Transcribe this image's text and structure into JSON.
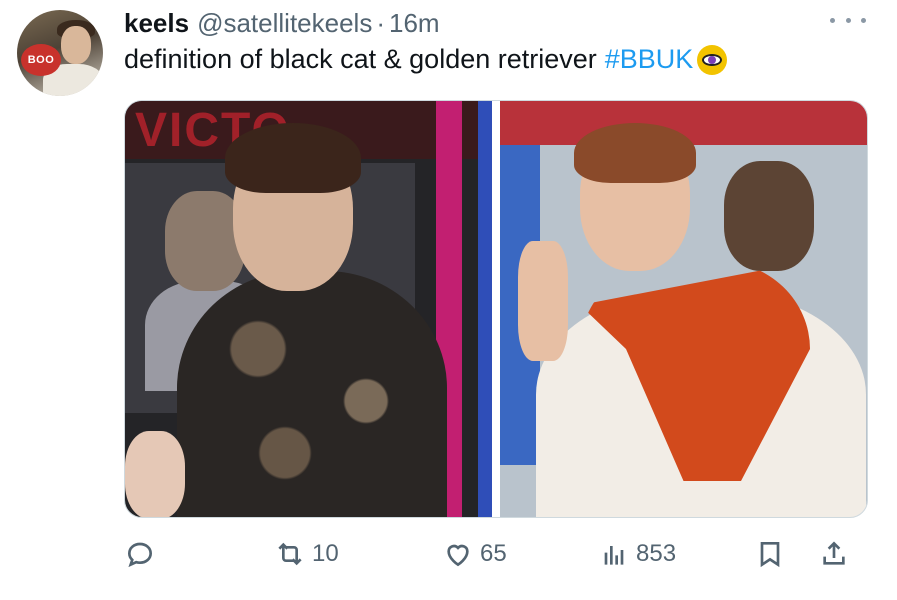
{
  "tweet": {
    "display_name": "keels",
    "handle": "@satellitekeels",
    "separator": "·",
    "time": "16m",
    "text": "definition of black cat & golden retriever",
    "hashtag": "#BBUK",
    "avatar_badge": "BOO"
  },
  "actions": {
    "reply_count": "",
    "retweet_count": "10",
    "like_count": "65",
    "views_count": "853"
  },
  "icons": [
    "reply-icon",
    "retweet-icon",
    "like-icon",
    "views-icon",
    "bookmark-icon",
    "share-icon",
    "more-icon",
    "eye-emoji"
  ],
  "colors": {
    "link": "#1d9bf0",
    "secondary": "#536471",
    "text": "#0f1419"
  }
}
